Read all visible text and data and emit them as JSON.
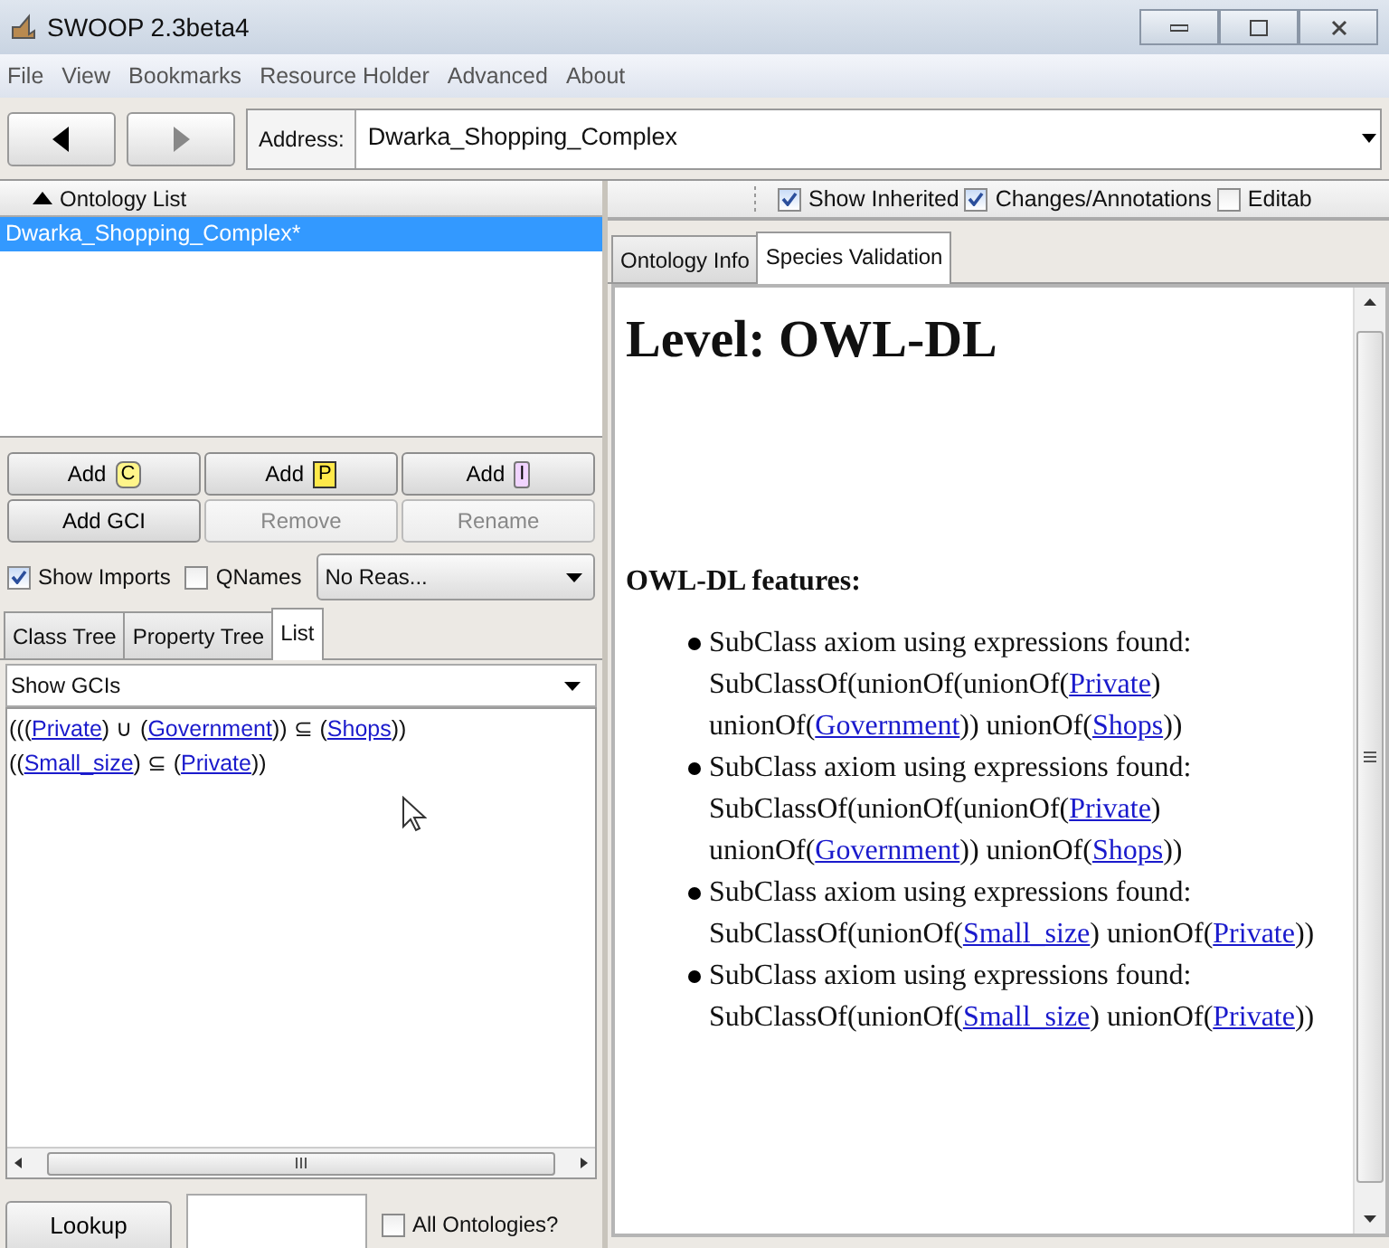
{
  "window": {
    "title": "SWOOP 2.3beta4"
  },
  "menu": [
    "File",
    "View",
    "Bookmarks",
    "Resource Holder",
    "Advanced",
    "About"
  ],
  "address": {
    "label": "Address:",
    "value": "Dwarka_Shopping_Complex"
  },
  "ontology_list": {
    "header": "Ontology List",
    "items": [
      {
        "label": "Dwarka_Shopping_Complex*",
        "selected": true
      }
    ]
  },
  "buttons": [
    {
      "label": "Add",
      "kind": "class",
      "glyph": "C",
      "disabled": false
    },
    {
      "label": "Add",
      "kind": "property",
      "glyph": "P",
      "disabled": false
    },
    {
      "label": "Add",
      "kind": "individual",
      "glyph": "I",
      "disabled": false
    },
    {
      "label": "Add GCI",
      "kind": "plain",
      "disabled": false
    },
    {
      "label": "Remove",
      "kind": "plain",
      "disabled": true
    },
    {
      "label": "Rename",
      "kind": "plain",
      "disabled": true
    }
  ],
  "options": [
    {
      "label": "Show Imports",
      "checked": true
    },
    {
      "label": "QNames",
      "checked": false
    }
  ],
  "reasoner": {
    "value": "No Reas..."
  },
  "left_tabs": [
    {
      "label": "Class Tree",
      "selected": false
    },
    {
      "label": "Property Tree",
      "selected": false
    },
    {
      "label": "List",
      "selected": true
    }
  ],
  "list_filter": {
    "value": "Show GCIs"
  },
  "gcis": [
    [
      {
        "kind": "text",
        "text": "((("
      },
      {
        "kind": "link",
        "text": "Private"
      },
      {
        "kind": "text",
        "text": ") ∪ ("
      },
      {
        "kind": "link",
        "text": "Government"
      },
      {
        "kind": "text",
        "text": ")) ⊆ ("
      },
      {
        "kind": "link",
        "text": "Shops"
      },
      {
        "kind": "text",
        "text": "))"
      }
    ],
    [
      {
        "kind": "text",
        "text": "(("
      },
      {
        "kind": "link",
        "text": "Small_size"
      },
      {
        "kind": "text",
        "text": ") ⊆ ("
      },
      {
        "kind": "link",
        "text": "Private"
      },
      {
        "kind": "text",
        "text": "))"
      }
    ]
  ],
  "lookup": {
    "button": "Lookup",
    "scope": {
      "label": "All Ontologies?",
      "checked": false
    }
  },
  "toolbar": [
    {
      "label": "Show Inherited",
      "checked": true
    },
    {
      "label": "Changes/Annotations",
      "checked": true
    },
    {
      "label": "Editab",
      "checked": false
    }
  ],
  "right_tabs": [
    {
      "label": "Ontology Info",
      "selected": false
    },
    {
      "label": "Species Validation",
      "selected": true
    }
  ],
  "content": {
    "heading": "Level: OWL-DL",
    "features_title": "OWL-DL features:",
    "features": [
      [
        {
          "kind": "text",
          "text": "SubClass axiom using expressions found: SubClassOf(unionOf(unionOf("
        },
        {
          "kind": "link",
          "text": "Private"
        },
        {
          "kind": "text",
          "text": ") unionOf("
        },
        {
          "kind": "link",
          "text": "Government"
        },
        {
          "kind": "text",
          "text": ")) unionOf("
        },
        {
          "kind": "link",
          "text": "Shops"
        },
        {
          "kind": "text",
          "text": "))"
        }
      ],
      [
        {
          "kind": "text",
          "text": "SubClass axiom using expressions found: SubClassOf(unionOf(unionOf("
        },
        {
          "kind": "link",
          "text": "Private"
        },
        {
          "kind": "text",
          "text": ") unionOf("
        },
        {
          "kind": "link",
          "text": "Government"
        },
        {
          "kind": "text",
          "text": ")) unionOf("
        },
        {
          "kind": "link",
          "text": "Shops"
        },
        {
          "kind": "text",
          "text": "))"
        }
      ],
      [
        {
          "kind": "text",
          "text": "SubClass axiom using expressions found: SubClassOf(unionOf("
        },
        {
          "kind": "link",
          "text": "Small_size"
        },
        {
          "kind": "text",
          "text": ") unionOf("
        },
        {
          "kind": "link",
          "text": "Private"
        },
        {
          "kind": "text",
          "text": "))"
        }
      ],
      [
        {
          "kind": "text",
          "text": "SubClass axiom using expressions found: SubClassOf(unionOf("
        },
        {
          "kind": "link",
          "text": "Small_size"
        },
        {
          "kind": "text",
          "text": ") unionOf("
        },
        {
          "kind": "link",
          "text": "Private"
        },
        {
          "kind": "text",
          "text": "))"
        }
      ]
    ]
  }
}
